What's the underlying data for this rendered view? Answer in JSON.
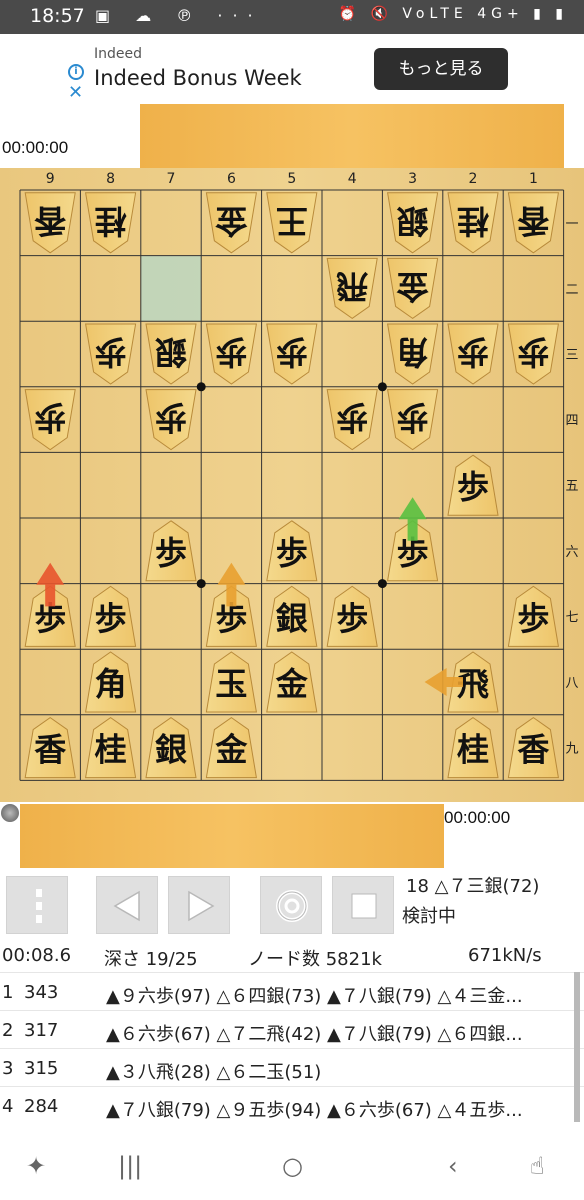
{
  "status_bar": {
    "time": "18:57",
    "left_icons": "▣ ☁ ℗ ···",
    "right_icons": "⏰ 🔇 VoLTE 4G+ ▮ ▮",
    "network": "4G+"
  },
  "ad": {
    "source": "Indeed",
    "title": "Indeed Bonus Week",
    "button": "もっと見る"
  },
  "timers": {
    "opponent": "00:00:00",
    "player": "00:00:00"
  },
  "board": {
    "columns": [
      "9",
      "8",
      "7",
      "6",
      "5",
      "4",
      "3",
      "2",
      "1"
    ],
    "rows": [
      "一",
      "二",
      "三",
      "四",
      "五",
      "六",
      "七",
      "八",
      "九"
    ],
    "highlight": {
      "col": 2,
      "row": 1
    },
    "pieces": [
      {
        "col": 0,
        "row": 0,
        "k": "香",
        "o": "w"
      },
      {
        "col": 1,
        "row": 0,
        "k": "桂",
        "o": "w"
      },
      {
        "col": 3,
        "row": 0,
        "k": "金",
        "o": "w"
      },
      {
        "col": 4,
        "row": 0,
        "k": "王",
        "o": "w"
      },
      {
        "col": 6,
        "row": 0,
        "k": "銀",
        "o": "w"
      },
      {
        "col": 7,
        "row": 0,
        "k": "桂",
        "o": "w"
      },
      {
        "col": 8,
        "row": 0,
        "k": "香",
        "o": "w"
      },
      {
        "col": 5,
        "row": 1,
        "k": "飛",
        "o": "w"
      },
      {
        "col": 6,
        "row": 1,
        "k": "金",
        "o": "w"
      },
      {
        "col": 1,
        "row": 2,
        "k": "歩",
        "o": "w"
      },
      {
        "col": 2,
        "row": 2,
        "k": "銀",
        "o": "w"
      },
      {
        "col": 3,
        "row": 2,
        "k": "歩",
        "o": "w"
      },
      {
        "col": 4,
        "row": 2,
        "k": "歩",
        "o": "w"
      },
      {
        "col": 6,
        "row": 2,
        "k": "角",
        "o": "w"
      },
      {
        "col": 7,
        "row": 2,
        "k": "歩",
        "o": "w"
      },
      {
        "col": 8,
        "row": 2,
        "k": "歩",
        "o": "w"
      },
      {
        "col": 0,
        "row": 3,
        "k": "歩",
        "o": "w"
      },
      {
        "col": 2,
        "row": 3,
        "k": "歩",
        "o": "w"
      },
      {
        "col": 5,
        "row": 3,
        "k": "歩",
        "o": "w"
      },
      {
        "col": 6,
        "row": 3,
        "k": "歩",
        "o": "w"
      },
      {
        "col": 7,
        "row": 4,
        "k": "歩",
        "o": "b"
      },
      {
        "col": 2,
        "row": 5,
        "k": "歩",
        "o": "b"
      },
      {
        "col": 4,
        "row": 5,
        "k": "歩",
        "o": "b"
      },
      {
        "col": 6,
        "row": 5,
        "k": "歩",
        "o": "b"
      },
      {
        "col": 0,
        "row": 6,
        "k": "歩",
        "o": "b"
      },
      {
        "col": 1,
        "row": 6,
        "k": "歩",
        "o": "b"
      },
      {
        "col": 3,
        "row": 6,
        "k": "歩",
        "o": "b"
      },
      {
        "col": 4,
        "row": 6,
        "k": "銀",
        "o": "b"
      },
      {
        "col": 5,
        "row": 6,
        "k": "歩",
        "o": "b"
      },
      {
        "col": 8,
        "row": 6,
        "k": "歩",
        "o": "b"
      },
      {
        "col": 1,
        "row": 7,
        "k": "角",
        "o": "b"
      },
      {
        "col": 3,
        "row": 7,
        "k": "玉",
        "o": "b"
      },
      {
        "col": 4,
        "row": 7,
        "k": "金",
        "o": "b"
      },
      {
        "col": 7,
        "row": 7,
        "k": "飛",
        "o": "b"
      },
      {
        "col": 0,
        "row": 8,
        "k": "香",
        "o": "b"
      },
      {
        "col": 1,
        "row": 8,
        "k": "桂",
        "o": "b"
      },
      {
        "col": 2,
        "row": 8,
        "k": "銀",
        "o": "b"
      },
      {
        "col": 3,
        "row": 8,
        "k": "金",
        "o": "b"
      },
      {
        "col": 7,
        "row": 8,
        "k": "桂",
        "o": "b"
      },
      {
        "col": 8,
        "row": 8,
        "k": "香",
        "o": "b"
      }
    ],
    "arrows": [
      {
        "color": "#e8542c",
        "from": [
          0,
          6
        ],
        "to": [
          0,
          5
        ]
      },
      {
        "color": "#e8a030",
        "from": [
          3,
          6
        ],
        "to": [
          3,
          5
        ]
      },
      {
        "color": "#5ac040",
        "from": [
          6,
          5
        ],
        "to": [
          6,
          4
        ]
      },
      {
        "color": "#e8a030",
        "from": [
          7,
          7
        ],
        "to": [
          6,
          7
        ]
      }
    ]
  },
  "move": {
    "last": "18 △７三銀(72)",
    "status": "検討中"
  },
  "engine": {
    "elapsed": "00:08.6",
    "depth": "深さ 19/25",
    "nodes": "ノード数 5821k",
    "nps": "671kN/s"
  },
  "pv": [
    {
      "n": "1",
      "score": "343",
      "line": "▲９六歩(97) △６四銀(73) ▲７八銀(79) △４三金..."
    },
    {
      "n": "2",
      "score": "317",
      "line": "▲６六歩(67) △７二飛(42) ▲７八銀(79) △６四銀..."
    },
    {
      "n": "3",
      "score": "315",
      "line": "▲３八飛(28) △６二玉(51)"
    },
    {
      "n": "4",
      "score": "284",
      "line": "▲７八銀(79) △９五歩(94) ▲６六歩(67) △４五歩..."
    }
  ]
}
